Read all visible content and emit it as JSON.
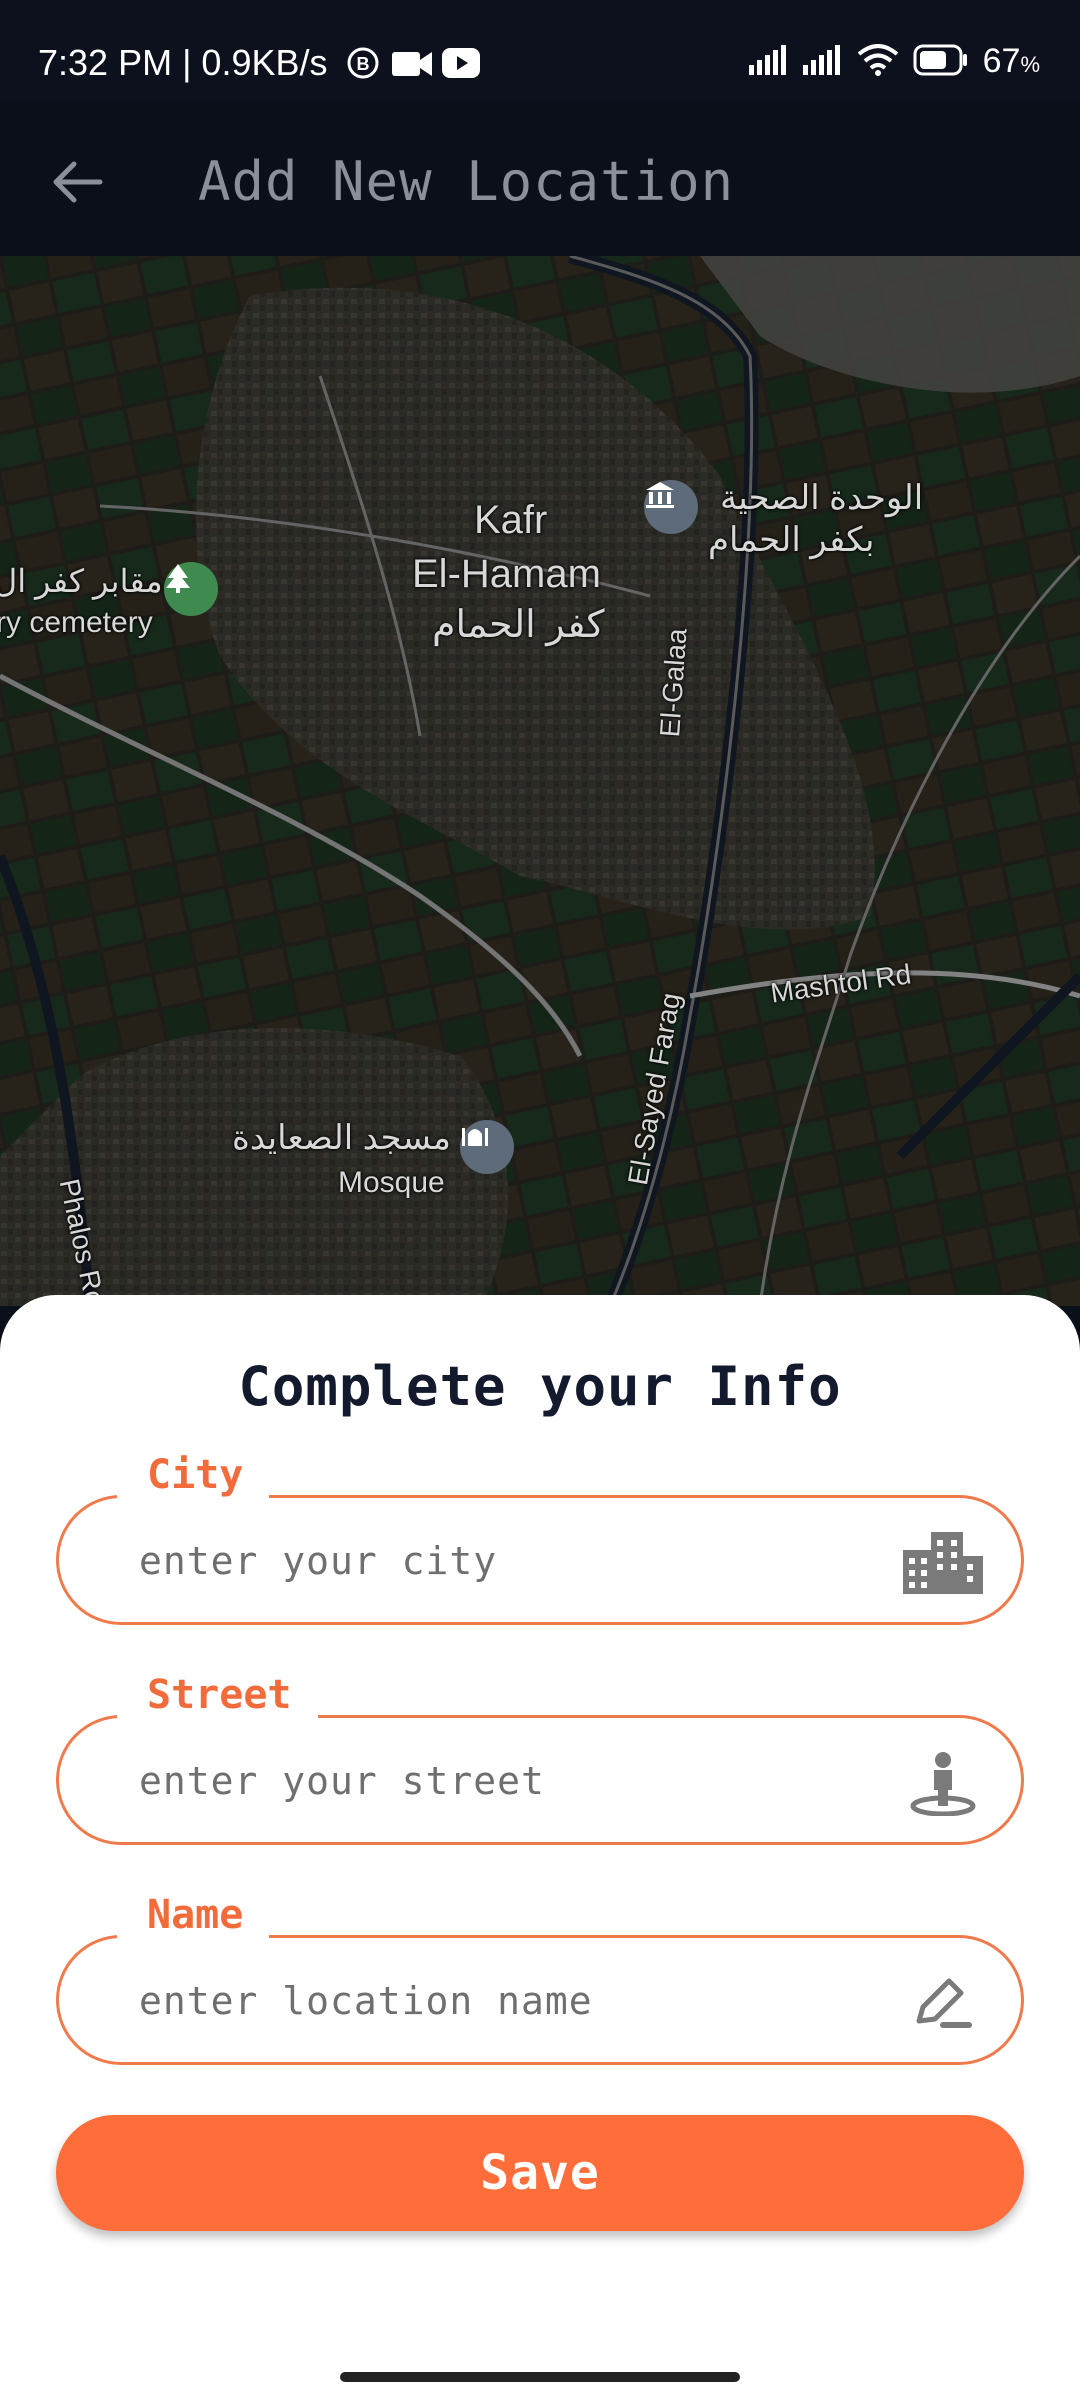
{
  "status_bar": {
    "time": "7:32 PM | 0.9KB/s",
    "battery": "67",
    "battery_unit": "%",
    "icons": [
      "bluetooth-icon",
      "video-icon",
      "youtube-icon",
      "signal-icon",
      "signal-icon",
      "wifi-icon",
      "battery-icon"
    ]
  },
  "app_bar": {
    "title": "Add New Location",
    "back_icon": "arrow-left-icon"
  },
  "map": {
    "labels": {
      "town_en_1": "Kafr",
      "town_en_2": "El-Hamam",
      "town_ar": "كفر الحمام",
      "health_unit_ar_1": "الوحدة الصحية",
      "health_unit_ar_2": "بكفر الحمام",
      "cemetery_ar": "مقابر كفر ال",
      "cemetery_en": "ry cemetery",
      "road_galaa": "El-Galaa",
      "road_mashtol": "Mashtol Rd",
      "road_sayed": "El-Sayed Farag",
      "mosque_ar": "مسجد الصعايدة",
      "mosque_en": "Mosque",
      "road_phalos": "Phalos Ro"
    }
  },
  "form": {
    "title": "Complete your Info",
    "fields": [
      {
        "label": "City",
        "placeholder": "enter your city",
        "icon": "city-icon"
      },
      {
        "label": "Street",
        "placeholder": "enter your street",
        "icon": "person-pin-icon"
      },
      {
        "label": "Name",
        "placeholder": "enter location name",
        "icon": "edit-icon"
      }
    ],
    "save_label": "Save"
  },
  "colors": {
    "accent": "#ff6d3a",
    "field_border": "#ef7a4c",
    "title": "#141a2e",
    "app_bar": "#0b0f1a"
  }
}
